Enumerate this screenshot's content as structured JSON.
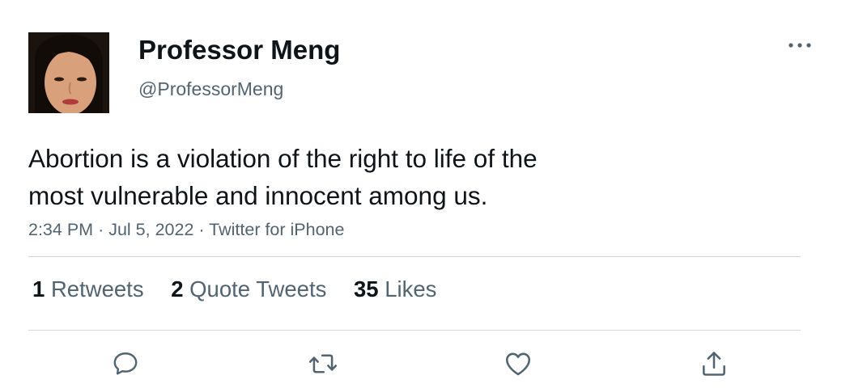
{
  "author": {
    "display_name": "Professor Meng",
    "handle": "@ProfessorMeng",
    "avatar_icon": "profile-photo"
  },
  "tweet": {
    "text_line1": "Abortion is a violation of the right to life of the",
    "text_line2": "most vulnerable and innocent among us.",
    "time": "2:34 PM",
    "separator": "·",
    "date": "Jul 5, 2022",
    "source": "Twitter for iPhone"
  },
  "stats": {
    "retweets_count": "1",
    "retweets_label": "Retweets",
    "quotes_count": "2",
    "quotes_label": "Quote Tweets",
    "likes_count": "35",
    "likes_label": "Likes"
  },
  "actions": [
    {
      "name": "reply",
      "icon": "speech-bubble-icon"
    },
    {
      "name": "retweet",
      "icon": "retweet-arrows-icon"
    },
    {
      "name": "like",
      "icon": "heart-icon"
    },
    {
      "name": "share",
      "icon": "share-upload-icon"
    }
  ],
  "colors": {
    "primary_text": "#0f1419",
    "secondary_text": "#536471",
    "divider": "#cfd9de",
    "icon": "#536471"
  }
}
